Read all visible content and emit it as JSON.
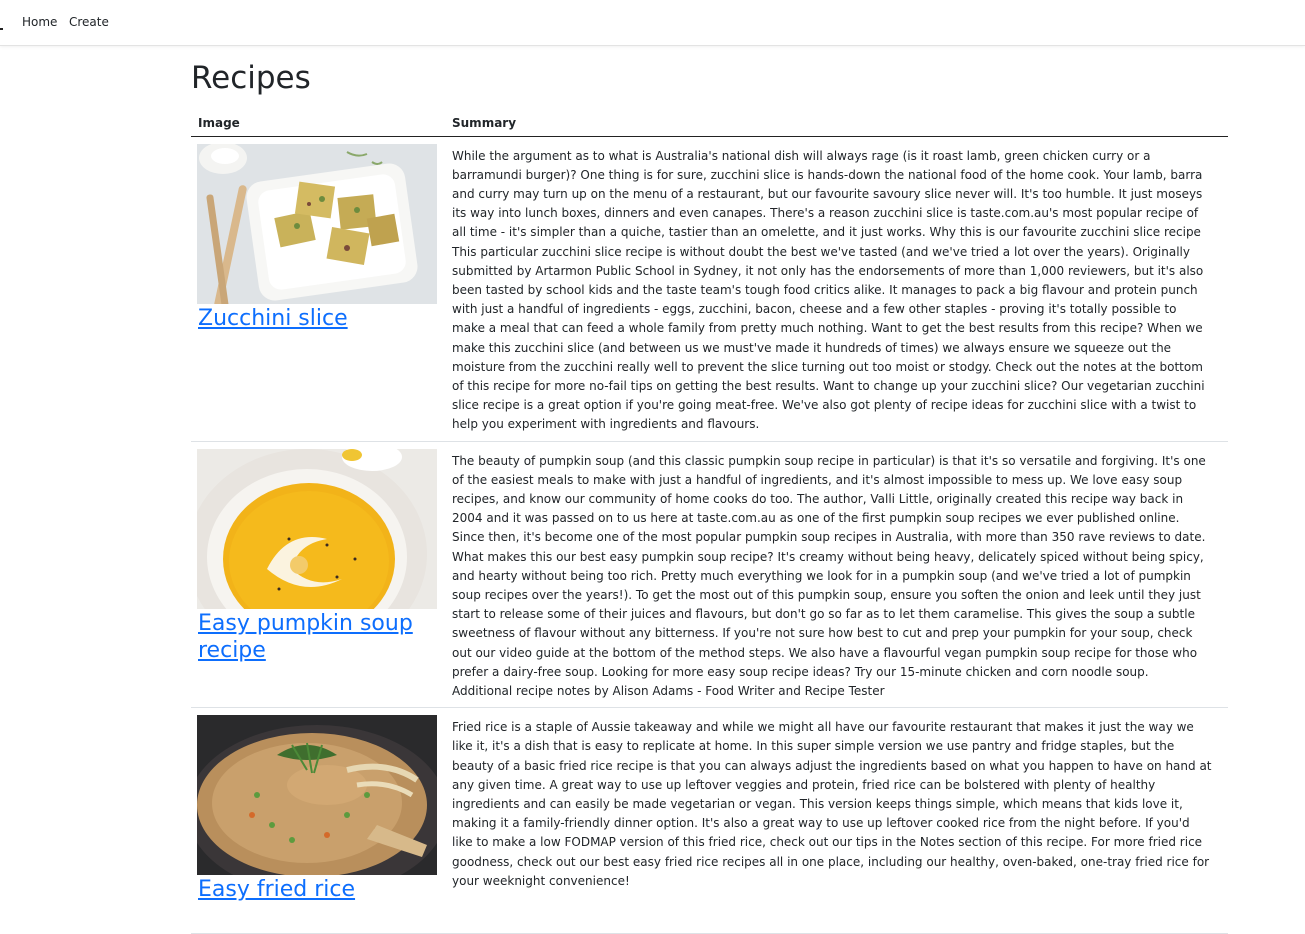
{
  "nav": {
    "home": "Home",
    "create": "Create"
  },
  "page": {
    "title": "Recipes"
  },
  "table": {
    "headers": {
      "image": "Image",
      "summary": "Summary"
    },
    "rows": [
      {
        "name": "Zucchini slice",
        "image_icon": "zucchini-slice-photo",
        "summary": "While the argument as to what is Australia's national dish will always rage (is it roast lamb, green chicken curry or a barramundi burger)? One thing is for sure, zucchini slice is hands-down the national food of the home cook. Your lamb, barra and curry may turn up on the menu of a restaurant, but our favourite savoury slice never will. It's too humble. It just moseys its way into lunch boxes, dinners and even canapes. There's a reason zucchini slice is taste.com.au's most popular recipe of all time - it's simpler than a quiche, tastier than an omelette, and it just works. Why this is our favourite zucchini slice recipe This particular zucchini slice recipe is without doubt the best we've tasted (and we've tried a lot over the years). Originally submitted by Artarmon Public School in Sydney, it not only has the endorsements of more than 1,000 reviewers, but it's also been tasted by school kids and the taste team's tough food critics alike. It manages to pack a big flavour and protein punch with just a handful of ingredients - eggs, zucchini, bacon, cheese and a few other staples - proving it's totally possible to make a meal that can feed a whole family from pretty much nothing. Want to get the best results from this recipe? When we make this zucchini slice (and between us we must've made it hundreds of times) we always ensure we squeeze out the moisture from the zucchini really well to prevent the slice turning out too moist or stodgy. Check out the notes at the bottom of this recipe for more no-fail tips on getting the best results. Want to change up your zucchini slice? Our vegetarian zucchini slice recipe is a great option if you're going meat-free. We've also got plenty of recipe ideas for zucchini slice with a twist to help you experiment with ingredients and flavours."
      },
      {
        "name": "Easy pumpkin soup recipe",
        "image_icon": "pumpkin-soup-photo",
        "summary": "The beauty of pumpkin soup (and this classic pumpkin soup recipe in particular) is that it's so versatile and forgiving. It's one of the easiest meals to make with just a handful of ingredients, and it's almost impossible to mess up. We love easy soup recipes, and know our community of home cooks do too. The author, Valli Little, originally created this recipe way back in 2004 and it was passed on to us here at taste.com.au as one of the first pumpkin soup recipes we ever published online. Since then, it's become one of the most popular pumpkin soup recipes in Australia, with more than 350 rave reviews to date. What makes this our best easy pumpkin soup recipe? It's creamy without being heavy, delicately spiced without being spicy, and hearty without being too rich. Pretty much everything we look for in a pumpkin soup (and we've tried a lot of pumpkin soup recipes over the years!). To get the most out of this pumpkin soup, ensure you soften the onion and leek until they just start to release some of their juices and flavours, but don't go so far as to let them caramelise. This gives the soup a subtle sweetness of flavour without any bitterness. If you're not sure how best to cut and prep your pumpkin for your soup, check out our video guide at the bottom of the method steps. We also have a flavourful vegan pumpkin soup recipe for those who prefer a dairy-free soup. Looking for more easy soup recipe ideas? Try our 15-minute chicken and corn noodle soup. Additional recipe notes by Alison Adams - Food Writer and Recipe Tester"
      },
      {
        "name": "Easy fried rice",
        "image_icon": "fried-rice-photo",
        "summary": "Fried rice is a staple of Aussie takeaway and while we might all have our favourite restaurant that makes it just the way we like it, it's a dish that is easy to replicate at home. In this super simple version we use pantry and fridge staples, but the beauty of a basic fried rice recipe is that you can always adjust the ingredients based on what you happen to have on hand at any given time. A great way to use up leftover veggies and protein, fried rice can be bolstered with plenty of healthy ingredients and can easily be made vegetarian or vegan. This version keeps things simple, which means that kids love it, making it a family-friendly dinner option. It's also a great way to use up leftover cooked rice from the night before. If you'd like to make a low FODMAP version of this fried rice, check out our tips in the Notes section of this recipe. For more fried rice goodness, check out our best easy fried rice recipes all in one place, including our healthy, oven-baked, one-tray fried rice for your weeknight convenience!"
      }
    ]
  },
  "colors": {
    "link": "#0d6efd",
    "text": "#212529",
    "row_border": "#dee2e6"
  }
}
